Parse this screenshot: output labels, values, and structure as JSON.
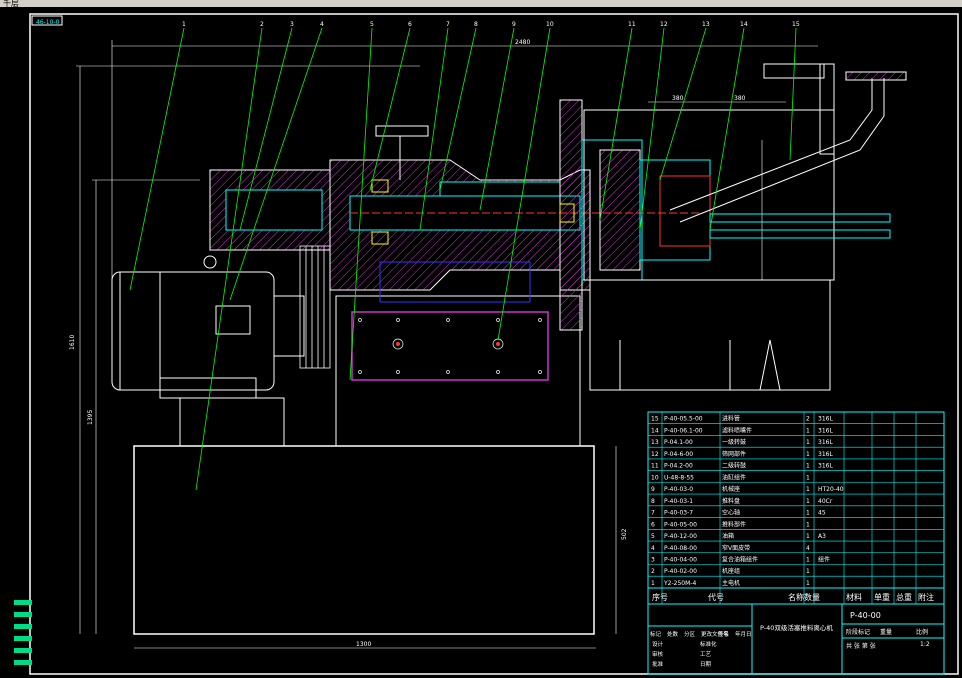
{
  "window": {
    "menu_label": "千层"
  },
  "drawing": {
    "corner_tag": "46-10-0",
    "colors": {
      "outline": "#ffffff",
      "part": "#00ffff",
      "hatch": "#cc33cc",
      "leader": "#00ff00",
      "dim": "#ffffff",
      "accent": "#ff3333",
      "blue": "#3333ff",
      "yellow": "#ffff00"
    },
    "balloons": [
      "1",
      "2",
      "3",
      "4",
      "5",
      "6",
      "7",
      "8",
      "9",
      "10",
      "11",
      "12",
      "13",
      "14",
      "15"
    ],
    "dims": {
      "overall_width": "2480",
      "overall_height": "1610",
      "lower_height": "1395",
      "base_height": "502",
      "base_width": "1300",
      "spacing_a": "380",
      "spacing_b": "380"
    }
  },
  "bom": {
    "rows": [
      {
        "no": "15",
        "code": "P-40-05.5-00",
        "name": "进料管",
        "qty": "2",
        "material": "316L",
        "remark": ""
      },
      {
        "no": "14",
        "code": "P-40-06.1-00",
        "name": "滤料喷嘴件",
        "qty": "1",
        "material": "316L",
        "remark": ""
      },
      {
        "no": "13",
        "code": "P-04.1-00",
        "name": "一级转鼓",
        "qty": "1",
        "material": "316L",
        "remark": ""
      },
      {
        "no": "12",
        "code": "P-04-6-00",
        "name": "筛网部件",
        "qty": "1",
        "material": "316L",
        "remark": ""
      },
      {
        "no": "11",
        "code": "P-04.2-00",
        "name": "二级转鼓",
        "qty": "1",
        "material": "316L",
        "remark": ""
      },
      {
        "no": "10",
        "code": "U-48-8-55",
        "name": "油缸组件",
        "qty": "1",
        "material": "",
        "remark": ""
      },
      {
        "no": "9",
        "code": "P-40-03-0",
        "name": "机械座",
        "qty": "1",
        "material": "HT20-40",
        "remark": ""
      },
      {
        "no": "8",
        "code": "P-40-03-1",
        "name": "推料盘",
        "qty": "1",
        "material": "40Cr",
        "remark": ""
      },
      {
        "no": "7",
        "code": "P-40-03-7",
        "name": "空心轴",
        "qty": "1",
        "material": "45",
        "remark": ""
      },
      {
        "no": "6",
        "code": "P-40-05-00",
        "name": "推料部件",
        "qty": "1",
        "material": "",
        "remark": ""
      },
      {
        "no": "5",
        "code": "P-40-12-00",
        "name": "油箱",
        "qty": "1",
        "material": "A3",
        "remark": ""
      },
      {
        "no": "4",
        "code": "P-40-08-00",
        "name": "窄V面皮带",
        "qty": "4",
        "material": "",
        "remark": ""
      },
      {
        "no": "3",
        "code": "P-40-04-00",
        "name": "复合油箱组件",
        "qty": "1",
        "material": "组件",
        "remark": ""
      },
      {
        "no": "2",
        "code": "P-40-02-00",
        "name": "机座组",
        "qty": "1",
        "material": "",
        "remark": ""
      },
      {
        "no": "1",
        "code": "Y2-250M-4",
        "name": "主电机",
        "qty": "1",
        "material": "",
        "remark": ""
      }
    ],
    "header": {
      "no": "序号",
      "code": "代号",
      "name": "名称",
      "qty": "数量",
      "material": "材料",
      "unit_weight": "单重",
      "total_weight": "总重",
      "remark": "附注"
    }
  },
  "title_block": {
    "drawing_no": "P-40-00",
    "title": "P-40双级活塞推料离心机",
    "stage": "阶段标记",
    "weight": "重量",
    "scale": "比例",
    "scale_value": "1:2",
    "sheet": "共 张 第 张",
    "labels": [
      "标记",
      "处数",
      "分区",
      "更改文件号",
      "签名",
      "年月日",
      "设计",
      "标准化",
      "审核",
      "工艺",
      "批准",
      "日期"
    ]
  }
}
